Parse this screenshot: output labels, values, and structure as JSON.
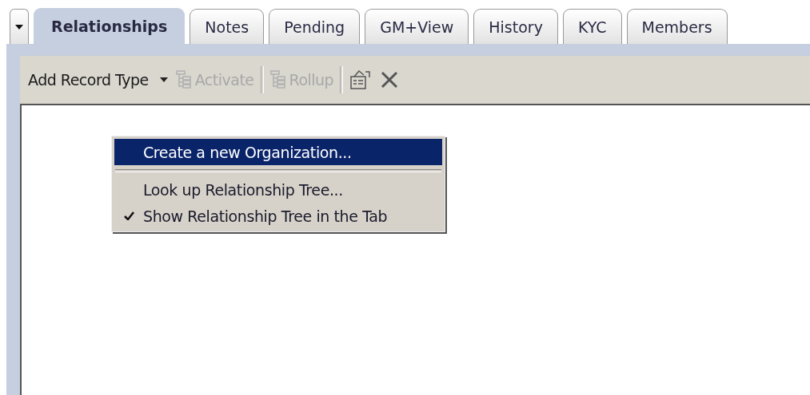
{
  "tabs": [
    {
      "label": "Relationships",
      "selected": true
    },
    {
      "label": "Notes",
      "selected": false
    },
    {
      "label": "Pending",
      "selected": false
    },
    {
      "label": "GM+View",
      "selected": false
    },
    {
      "label": "History",
      "selected": false
    },
    {
      "label": "KYC",
      "selected": false
    },
    {
      "label": "Members",
      "selected": false
    }
  ],
  "toolbar": [
    {
      "kind": "dropdown",
      "label": "Add Record Type",
      "disabled": false
    },
    {
      "kind": "tree_button",
      "label": "Activate",
      "disabled": true
    },
    {
      "kind": "separator"
    },
    {
      "kind": "tree_button",
      "label": "Rollup",
      "disabled": true
    },
    {
      "kind": "separator"
    },
    {
      "kind": "properties",
      "disabled": false
    },
    {
      "kind": "delete",
      "disabled": false
    }
  ],
  "context_menu": [
    {
      "kind": "item",
      "label": "Create a new Organization...",
      "selected": true,
      "checked": false
    },
    {
      "kind": "separator"
    },
    {
      "kind": "item",
      "label": "Look up Relationship Tree...",
      "selected": false,
      "checked": false
    },
    {
      "kind": "item",
      "label": "Show Relationship Tree in the Tab",
      "selected": false,
      "checked": true
    }
  ]
}
